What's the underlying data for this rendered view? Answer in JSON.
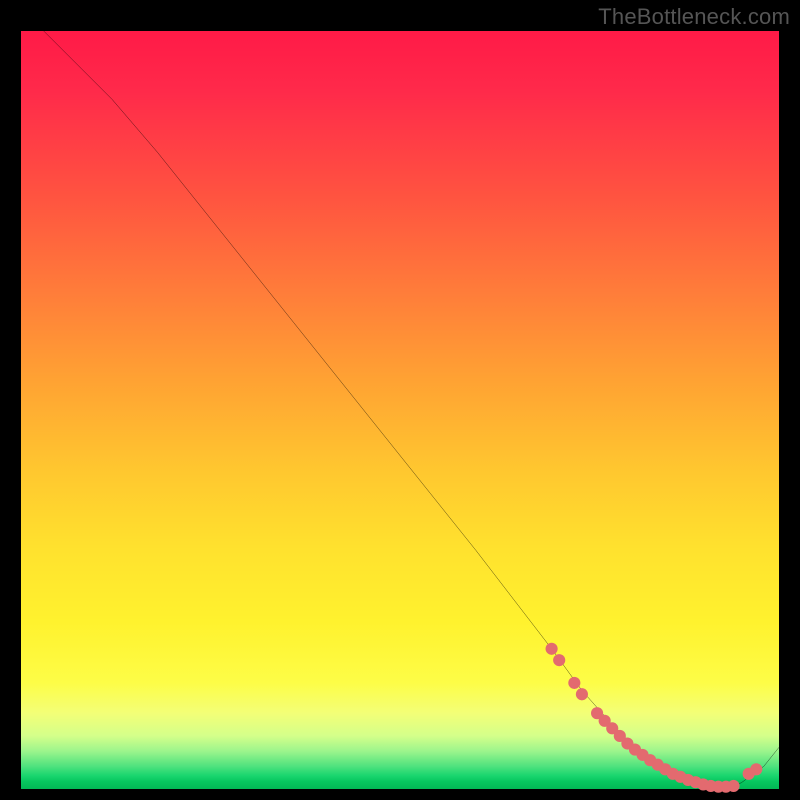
{
  "watermark": "TheBottleneck.com",
  "chart_data": {
    "type": "line",
    "title": "",
    "xlabel": "",
    "ylabel": "",
    "xlim": [
      0,
      100
    ],
    "ylim": [
      0,
      100
    ],
    "grid": false,
    "series": [
      {
        "name": "curve",
        "x": [
          3,
          8,
          12,
          18,
          24,
          30,
          36,
          42,
          48,
          54,
          60,
          65,
          70,
          74,
          78,
          82,
          86,
          89,
          92,
          95,
          98,
          100
        ],
        "y": [
          100,
          95,
          91,
          84,
          76.5,
          69,
          61.5,
          54,
          46.5,
          39,
          31.5,
          25,
          18.5,
          13,
          8.5,
          4.5,
          1.8,
          0.6,
          0.2,
          0.8,
          3,
          5.5
        ]
      }
    ],
    "scatter": {
      "name": "markers",
      "color": "#e36a6f",
      "x": [
        70,
        71,
        73,
        74,
        76,
        77,
        78,
        79,
        80,
        81,
        82,
        83,
        84,
        85,
        86,
        87,
        88,
        89,
        90,
        91,
        92,
        93,
        94,
        96,
        97
      ],
      "y": [
        18.5,
        17,
        14,
        12.5,
        10,
        9,
        8,
        7,
        6,
        5.2,
        4.5,
        3.8,
        3.2,
        2.6,
        2,
        1.6,
        1.2,
        0.9,
        0.6,
        0.4,
        0.3,
        0.3,
        0.4,
        2,
        2.6
      ]
    }
  }
}
